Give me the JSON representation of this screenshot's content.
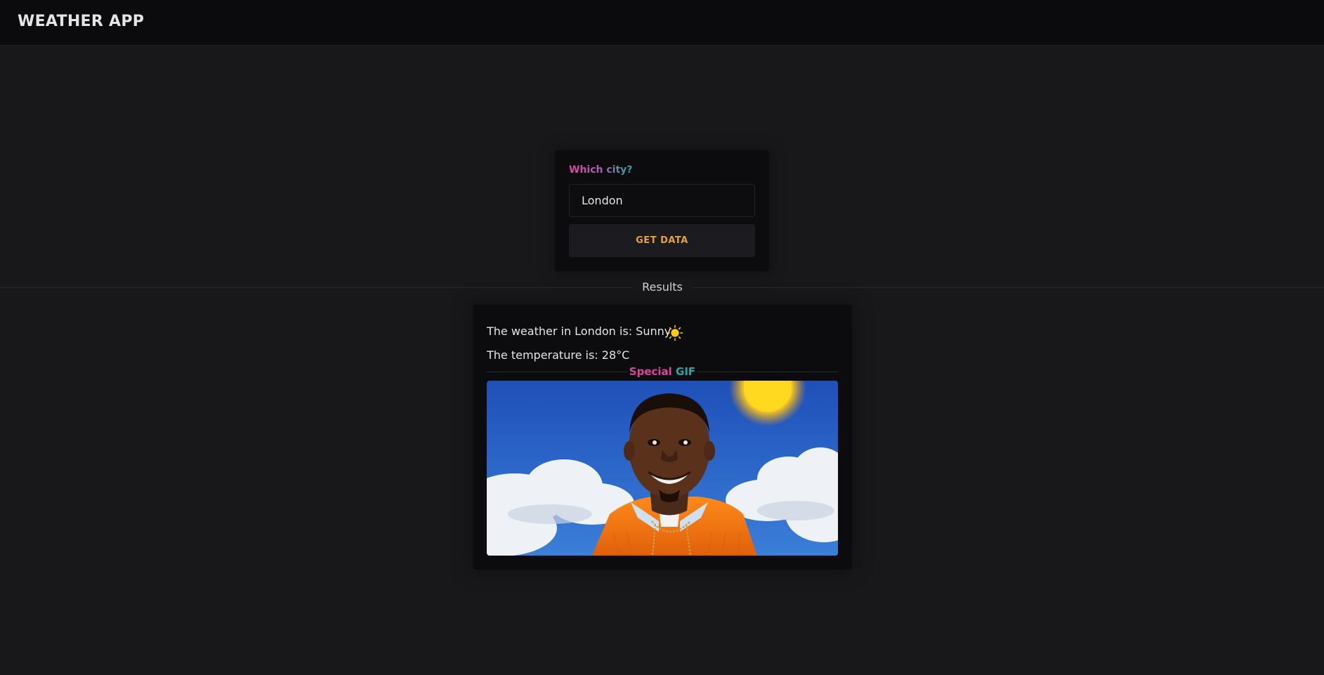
{
  "header": {
    "title": "WEATHER APP"
  },
  "form": {
    "label_part1": "Which",
    "label_part2": " city?",
    "city_value": "London",
    "button_label": "GET DATA"
  },
  "results": {
    "section_label": "Results",
    "weather_text": "The weather in London is: Sunny",
    "weather_icon": "sun-icon",
    "temperature_text": "The temperature is: 28°C",
    "gif_label_part1": "Special",
    "gif_label_part2": " GIF",
    "gif_description": "person smiling in front of blue sky with clouds and sun"
  },
  "colors": {
    "background": "#18181b",
    "topbar": "#0b0b0d",
    "card": "#0c0c0e",
    "button_text": "#e3a33c",
    "accent_pink": "#d946a0",
    "accent_teal": "#2aa6a6",
    "sun": "#facc15"
  }
}
